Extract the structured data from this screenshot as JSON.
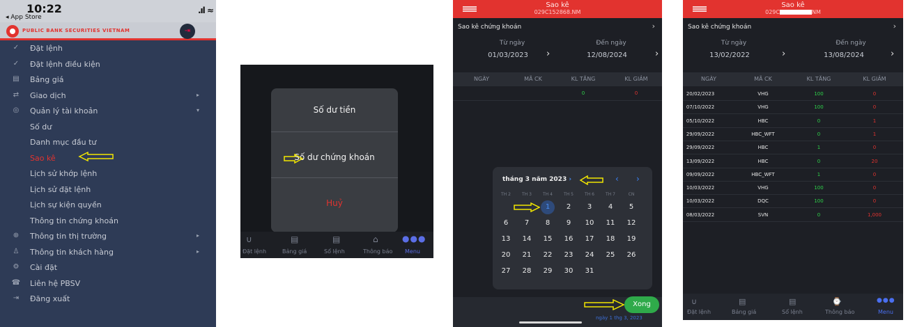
{
  "menu": {
    "status": {
      "time": "10:22",
      "back": "◂ App Store"
    },
    "brand": "PUBLIC BANK SECURITIES VIETNAM",
    "items": [
      {
        "icon": "pencil-icon",
        "glyph": "✓",
        "label": "Đặt lệnh",
        "chevron": ""
      },
      {
        "icon": "pencil-icon",
        "glyph": "✓",
        "label": "Đặt lệnh điều kiện",
        "chevron": ""
      },
      {
        "icon": "table-icon",
        "glyph": "▤",
        "label": "Bảng giá",
        "chevron": ""
      },
      {
        "icon": "exchange-icon",
        "glyph": "⇄",
        "label": "Giao dịch",
        "chevron": "▸"
      },
      {
        "icon": "account-icon",
        "glyph": "◎",
        "label": "Quản lý tài khoản",
        "chevron": "▾"
      },
      {
        "icon": "",
        "glyph": "",
        "label": "Số dư",
        "chevron": ""
      },
      {
        "icon": "",
        "glyph": "",
        "label": "Danh mục đầu tư",
        "chevron": ""
      },
      {
        "icon": "",
        "glyph": "",
        "label": "Sao kê",
        "chevron": ""
      },
      {
        "icon": "",
        "glyph": "",
        "label": "Lịch sử khớp lệnh",
        "chevron": ""
      },
      {
        "icon": "",
        "glyph": "",
        "label": "Lịch sử đặt lệnh",
        "chevron": ""
      },
      {
        "icon": "",
        "glyph": "",
        "label": "Lịch sự kiện quyền",
        "chevron": ""
      },
      {
        "icon": "",
        "glyph": "",
        "label": "Thông tin chứng khoán",
        "chevron": ""
      },
      {
        "icon": "globe-icon",
        "glyph": "⊕",
        "label": "Thông tin thị trường",
        "chevron": "▸"
      },
      {
        "icon": "user-icon",
        "glyph": "♙",
        "label": "Thông tin khách hàng",
        "chevron": "▸"
      },
      {
        "icon": "gear-icon",
        "glyph": "⚙",
        "label": "Cài đặt",
        "chevron": ""
      },
      {
        "icon": "contact-icon",
        "glyph": "☎",
        "label": "Liên hệ PBSV",
        "chevron": ""
      },
      {
        "icon": "logout-icon",
        "glyph": "⇥",
        "label": "Đăng xuất",
        "chevron": ""
      }
    ]
  },
  "popup": {
    "options": [
      "Số dư tiền",
      "Số dư chứng khoán",
      "Huỷ"
    ],
    "tabs": [
      "Đặt lệnh",
      "Bảng giá",
      "Sổ lệnh",
      "Thông báo",
      "Menu"
    ]
  },
  "statement": {
    "title": "Sao kê",
    "account_p3": "029C152868.NM",
    "account_p4_prefix": "029C",
    "account_p4_suffix": "NM",
    "subtitle": "Sao kê chứng khoán",
    "from_label": "Từ ngày",
    "to_label": "Đến ngày",
    "p3_from": "01/03/2023",
    "p3_to": "12/08/2024",
    "p4_from": "13/02/2022",
    "p4_to": "13/08/2024",
    "columns": [
      "NGÀY",
      "MÃ CK",
      "KL TĂNG",
      "KL GIẢM"
    ],
    "p3_row": {
      "inc": "0",
      "dec": "0"
    },
    "rows": [
      {
        "date": "20/02/2023",
        "code": "VHG",
        "inc": "100",
        "dec": "0"
      },
      {
        "date": "07/10/2022",
        "code": "VHG",
        "inc": "100",
        "dec": "0"
      },
      {
        "date": "05/10/2022",
        "code": "HBC",
        "inc": "0",
        "dec": "1"
      },
      {
        "date": "29/09/2022",
        "code": "HBC_WFT",
        "inc": "0",
        "dec": "1"
      },
      {
        "date": "29/09/2022",
        "code": "HBC",
        "inc": "1",
        "dec": "0"
      },
      {
        "date": "13/09/2022",
        "code": "HBC",
        "inc": "0",
        "dec": "20"
      },
      {
        "date": "09/09/2022",
        "code": "HBC_WFT",
        "inc": "1",
        "dec": "0"
      },
      {
        "date": "10/03/2022",
        "code": "VHG",
        "inc": "100",
        "dec": "0"
      },
      {
        "date": "10/03/2022",
        "code": "DQC",
        "inc": "100",
        "dec": "0"
      },
      {
        "date": "08/03/2022",
        "code": "SVN",
        "inc": "0",
        "dec": "1,000"
      }
    ],
    "tabs": [
      "Đặt lệnh",
      "Bảng giá",
      "Sổ lệnh",
      "Thông báo",
      "Menu"
    ]
  },
  "calendar": {
    "month": "tháng 3 năm 2023",
    "weekdays": [
      "TH 2",
      "TH 3",
      "TH 4",
      "TH 5",
      "TH 6",
      "TH 7",
      "CN"
    ],
    "weeks": [
      [
        "",
        "",
        "1",
        "2",
        "3",
        "4",
        "5"
      ],
      [
        "6",
        "7",
        "8",
        "9",
        "10",
        "11",
        "12"
      ],
      [
        "13",
        "14",
        "15",
        "16",
        "17",
        "18",
        "19"
      ],
      [
        "20",
        "21",
        "22",
        "23",
        "24",
        "25",
        "26"
      ],
      [
        "27",
        "28",
        "29",
        "30",
        "31",
        "",
        ""
      ]
    ],
    "selected": "1",
    "done_label": "Xong",
    "footer": "ngày 1 thg 3, 2023"
  },
  "colors": {
    "brand_red": "#e2332f",
    "up_green": "#2ed34a",
    "down_red": "#e2332f",
    "accent_blue": "#3b82f6",
    "annotation_yellow": "#f2e600"
  }
}
